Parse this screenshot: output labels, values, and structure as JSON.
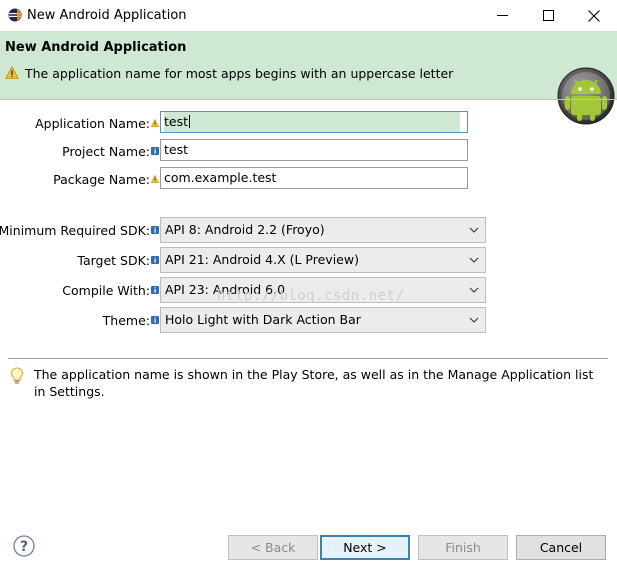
{
  "window": {
    "title": "New Android Application",
    "controls": {
      "minimize_icon": "minimize-icon",
      "maximize_icon": "maximize-icon",
      "close_icon": "close-icon"
    }
  },
  "header": {
    "title": "New Android Application",
    "message": "The application name for most apps begins with an uppercase letter",
    "message_icon": "warning-icon",
    "logo": "android-logo",
    "color": "#cfe8d3"
  },
  "form": {
    "application_name": {
      "label": "Application Name:",
      "value": "test",
      "decoration": "warning"
    },
    "project_name": {
      "label": "Project Name:",
      "value": "test",
      "decoration": "info"
    },
    "package_name": {
      "label": "Package Name:",
      "value": "com.example.test",
      "decoration": "warning"
    },
    "min_sdk": {
      "label": "Minimum Required SDK:",
      "value": "API 8: Android 2.2 (Froyo)"
    },
    "target_sdk": {
      "label": "Target SDK:",
      "value": "API 21: Android 4.X (L Preview)"
    },
    "compile_with": {
      "label": "Compile With:",
      "value": "API 23: Android 6.0"
    },
    "theme": {
      "label": "Theme:",
      "value": "Holo Light with Dark Action Bar"
    }
  },
  "watermark": "http://blog.csdn.net/",
  "info": {
    "icon": "lightbulb-icon",
    "text": "The application name is shown in the Play Store, as well as in the Manage Application list in Settings."
  },
  "buttons": {
    "help_icon": "help-icon",
    "back": "< Back",
    "next": "Next >",
    "finish": "Finish",
    "cancel": "Cancel"
  }
}
